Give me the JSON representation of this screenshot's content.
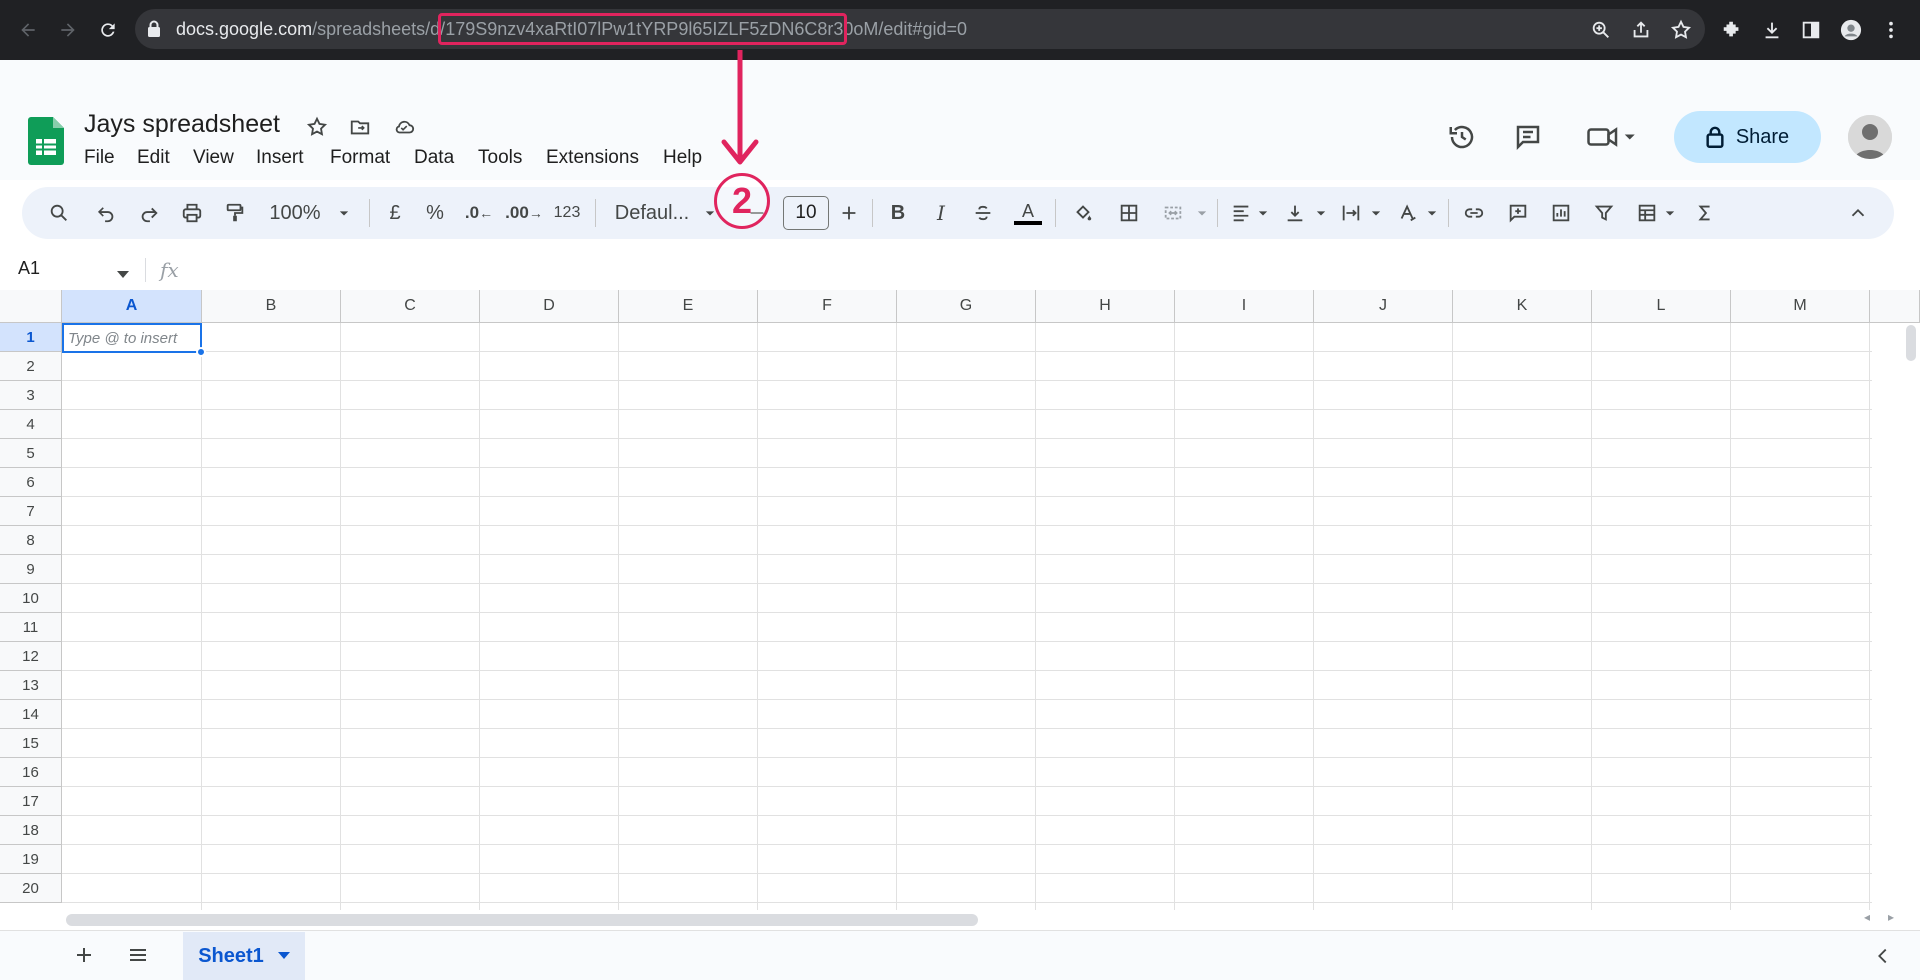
{
  "browser": {
    "url_host": "docs.google.com",
    "url_path_start": "/spreadsheets/d/",
    "url_id": "179S9nzv4xaRtI07lPw1tYRP9l65IZLF5zDN6C8r30oM",
    "url_path_end": "/edit#gid=0"
  },
  "header": {
    "doc_title": "Jays spreadsheet",
    "menu": [
      "File",
      "Edit",
      "View",
      "Insert",
      "Format",
      "Data",
      "Tools",
      "Extensions",
      "Help"
    ],
    "share_label": "Share"
  },
  "toolbar": {
    "zoom": "100%",
    "currency": "£",
    "percent": "%",
    "decrease_decimals": ".0",
    "increase_decimals": ".00",
    "number_format": "123",
    "font": "Defaul...",
    "font_size": "10",
    "bold": "B",
    "italic": "I",
    "text_color_letter": "A"
  },
  "annotation": {
    "step": "2",
    "color": "#e0245e"
  },
  "formula_bar": {
    "name_box": "A1",
    "fx": "fx"
  },
  "grid": {
    "columns": [
      "A",
      "B",
      "C",
      "D",
      "E",
      "F",
      "G",
      "H",
      "I",
      "J",
      "K",
      "L",
      "M"
    ],
    "rows": [
      "1",
      "2",
      "3",
      "4",
      "5",
      "6",
      "7",
      "8",
      "9",
      "10",
      "11",
      "12",
      "13",
      "14",
      "15",
      "16",
      "17",
      "18",
      "19",
      "20"
    ],
    "active_cell_placeholder": "Type @ to insert"
  },
  "sheets": {
    "active_tab": "Sheet1"
  },
  "colors": {
    "accent": "#1a73e8",
    "share_bg": "#c2e7ff",
    "sheet_tab_text": "#0b57d0"
  }
}
